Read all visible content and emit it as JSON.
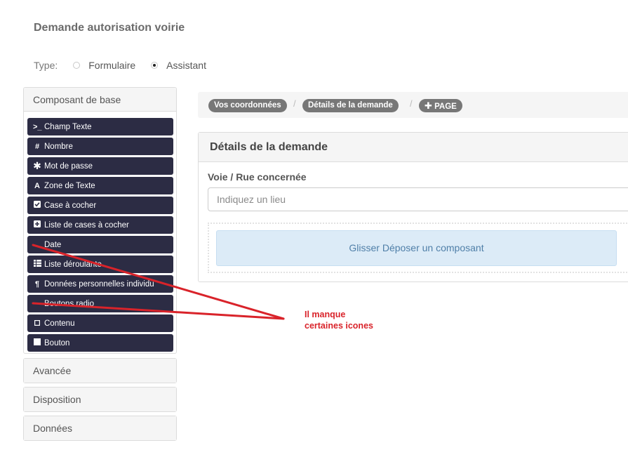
{
  "form": {
    "title": "Demande autorisation voirie"
  },
  "type": {
    "label": "Type:",
    "options": [
      {
        "label": "Formulaire",
        "checked": false
      },
      {
        "label": "Assistant",
        "checked": true
      }
    ]
  },
  "sidebar": {
    "base": {
      "title": "Composant de base",
      "items": [
        {
          "label": "Champ Texte",
          "icon": "terminal-icon"
        },
        {
          "label": "Nombre",
          "icon": "hash-icon"
        },
        {
          "label": "Mot de passe",
          "icon": "asterisk-icon"
        },
        {
          "label": "Zone de Texte",
          "icon": "font-icon"
        },
        {
          "label": "Case à cocher",
          "icon": "check-square-icon"
        },
        {
          "label": "Liste de cases à cocher",
          "icon": "plus-square-icon"
        },
        {
          "label": "Date",
          "icon": ""
        },
        {
          "label": "Liste déroulante",
          "icon": "th-list-icon"
        },
        {
          "label": "Données personnelles individu",
          "icon": "paragraph-icon"
        },
        {
          "label": "Boutons radio",
          "icon": ""
        },
        {
          "label": "Contenu",
          "icon": "square-outline-icon"
        },
        {
          "label": "Bouton",
          "icon": "stop-icon"
        }
      ]
    },
    "avancee": "Avancée",
    "disposition": "Disposition",
    "donnees": "Données"
  },
  "breadcrumb": [
    "Vos coordonnées",
    "Détails de la demande",
    "PAGE"
  ],
  "page": {
    "title": "Détails de la demande",
    "field_label": "Voie / Rue concernée",
    "field_placeholder": "Indiquez un lieu",
    "drop_text": "Glisser Déposer un composant"
  },
  "annotation": {
    "line1": "Il manque",
    "line2": "certaines icones",
    "color": "#d9232a"
  },
  "colors": {
    "component_bg": "#2c2c44",
    "crumb_bg": "#777777",
    "drop_bg": "#dcebf7"
  }
}
